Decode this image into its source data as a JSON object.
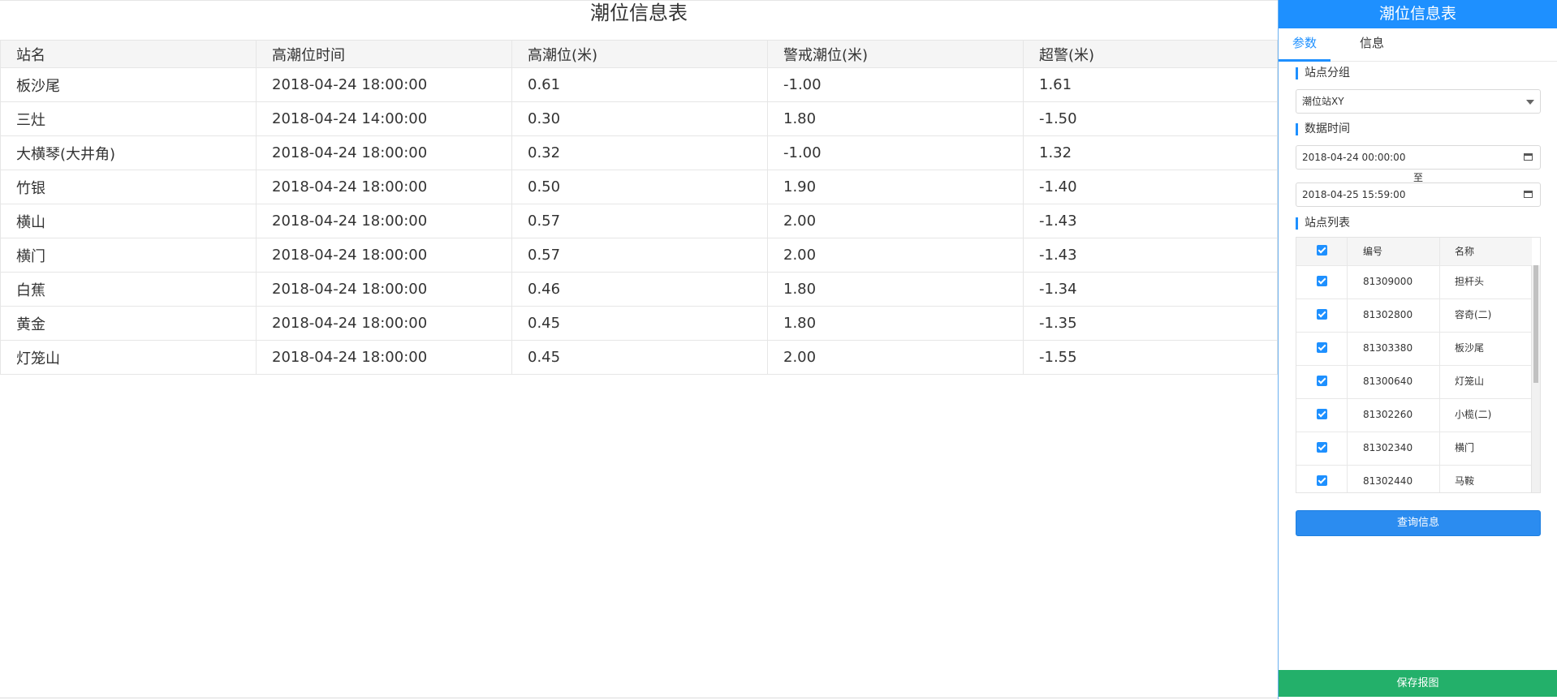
{
  "report": {
    "title": "潮位信息表",
    "columns": [
      "站名",
      "高潮位时间",
      "高潮位(米)",
      "警戒潮位(米)",
      "超警(米)"
    ],
    "rows": [
      [
        "板沙尾",
        "2018-04-24 18:00:00",
        "0.61",
        "-1.00",
        "1.61"
      ],
      [
        "三灶",
        "2018-04-24 14:00:00",
        "0.30",
        "1.80",
        "-1.50"
      ],
      [
        "大横琴(大井角)",
        "2018-04-24 18:00:00",
        "0.32",
        "-1.00",
        "1.32"
      ],
      [
        "竹银",
        "2018-04-24 18:00:00",
        "0.50",
        "1.90",
        "-1.40"
      ],
      [
        "横山",
        "2018-04-24 18:00:00",
        "0.57",
        "2.00",
        "-1.43"
      ],
      [
        "横门",
        "2018-04-24 18:00:00",
        "0.57",
        "2.00",
        "-1.43"
      ],
      [
        "白蕉",
        "2018-04-24 18:00:00",
        "0.46",
        "1.80",
        "-1.34"
      ],
      [
        "黄金",
        "2018-04-24 18:00:00",
        "0.45",
        "1.80",
        "-1.35"
      ],
      [
        "灯笼山",
        "2018-04-24 18:00:00",
        "0.45",
        "2.00",
        "-1.55"
      ]
    ]
  },
  "panel": {
    "title": "潮位信息表",
    "tabs": [
      {
        "label": "参数",
        "active": true
      },
      {
        "label": "信息",
        "active": false
      }
    ],
    "station_group_label": "站点分组",
    "station_group_value": "潮位站XY",
    "data_time_label": "数据时间",
    "start_time": "2018-04-24 00:00:00",
    "range_separator": "至",
    "end_time": "2018-04-25 15:59:00",
    "station_list_label": "站点列表",
    "grid_headers": {
      "code": "编号",
      "name": "名称"
    },
    "stations": [
      {
        "code": "81309000",
        "name": "担杆头",
        "checked": true
      },
      {
        "code": "81302800",
        "name": "容奇(二)",
        "checked": true
      },
      {
        "code": "81303380",
        "name": "板沙尾",
        "checked": true
      },
      {
        "code": "81300640",
        "name": "灯笼山",
        "checked": true
      },
      {
        "code": "81302260",
        "name": "小榄(二)",
        "checked": true
      },
      {
        "code": "81302340",
        "name": "横门",
        "checked": true
      },
      {
        "code": "81302440",
        "name": "马鞍",
        "checked": true
      }
    ],
    "query_button": "查询信息",
    "save_button": "保存报图"
  },
  "colors": {
    "accent": "#1e90ff",
    "save": "#23b06a",
    "header_bg": "#f5f5f5"
  }
}
